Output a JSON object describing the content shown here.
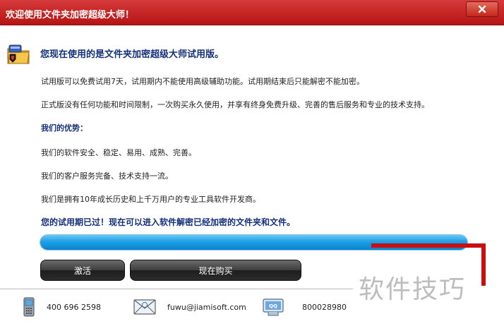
{
  "window": {
    "title": "欢迎使用文件夹加密超级大师！",
    "close_label": "×"
  },
  "main": {
    "heading": "您现在使用的是文件夹加密超级大师试用版。",
    "trial_info": "试用版可以免费试用7天，试用期内不能使用高级辅助功能。试用期结束后只能解密不能加密。",
    "full_info": "正式版没有任何功能和时间限制，一次购买永久使用，并享有终身免费升级、完善的售后服务和专业的技术支持。",
    "advantages_title": "我们的优势：",
    "advantages": [
      "我们的软件安全、稳定、易用、成熟、完善。",
      "我们的客户服务完备、技术支持一流。",
      "我们是拥有10年成长历史和上千万用户的专业工具软件开发商。"
    ],
    "expired_notice": "您的试用期已过！现在可以进入软件解密已经加密的文件夹和文件。",
    "progress": 1.0
  },
  "buttons": {
    "activate": "激活",
    "buy": "现在购买"
  },
  "footer": {
    "phone": "400 696 2598",
    "email": "fuwu@jiamisoft.com",
    "qq": "800028980"
  },
  "watermark": "软件技巧",
  "colors": {
    "title_bar": "#c41e1e",
    "heading": "#15307a",
    "progress": "#1ea0e6",
    "highlight_frame": "#c80f12"
  }
}
